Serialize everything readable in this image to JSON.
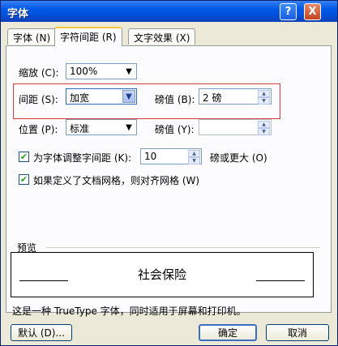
{
  "window": {
    "title": "字体",
    "help_glyph": "?",
    "close_glyph": "X"
  },
  "tabs": [
    {
      "label": "字体 (N)"
    },
    {
      "label": "字符间距 (R)"
    },
    {
      "label": "文字效果 (X)"
    }
  ],
  "scale": {
    "label": "缩放 (C):",
    "value": "100%"
  },
  "spacing": {
    "label": "间距 (S):",
    "value": "加宽",
    "points_label": "磅值 (B):",
    "points_value": "2 磅"
  },
  "position": {
    "label": "位置 (P):",
    "value": "标准",
    "points_label": "磅值 (Y):",
    "points_value": ""
  },
  "kerning": {
    "label": "为字体调整字间距 (K):",
    "checked": true,
    "value": "10",
    "suffix": "磅或更大 (O)"
  },
  "grid": {
    "label": "如果定义了文档网格，则对齐网格 (W)",
    "checked": true
  },
  "preview": {
    "group_label": "预览",
    "sample_text": "社会保险"
  },
  "note": "这是一种 TrueType 字体，同时适用于屏幕和打印机。",
  "buttons": {
    "default": "默认 (D)...",
    "ok": "确定",
    "cancel": "取消"
  },
  "colors": {
    "titlebar": "#0054e3",
    "highlight": "#d63a3a",
    "tab_active_accent": "#ffc83c"
  }
}
